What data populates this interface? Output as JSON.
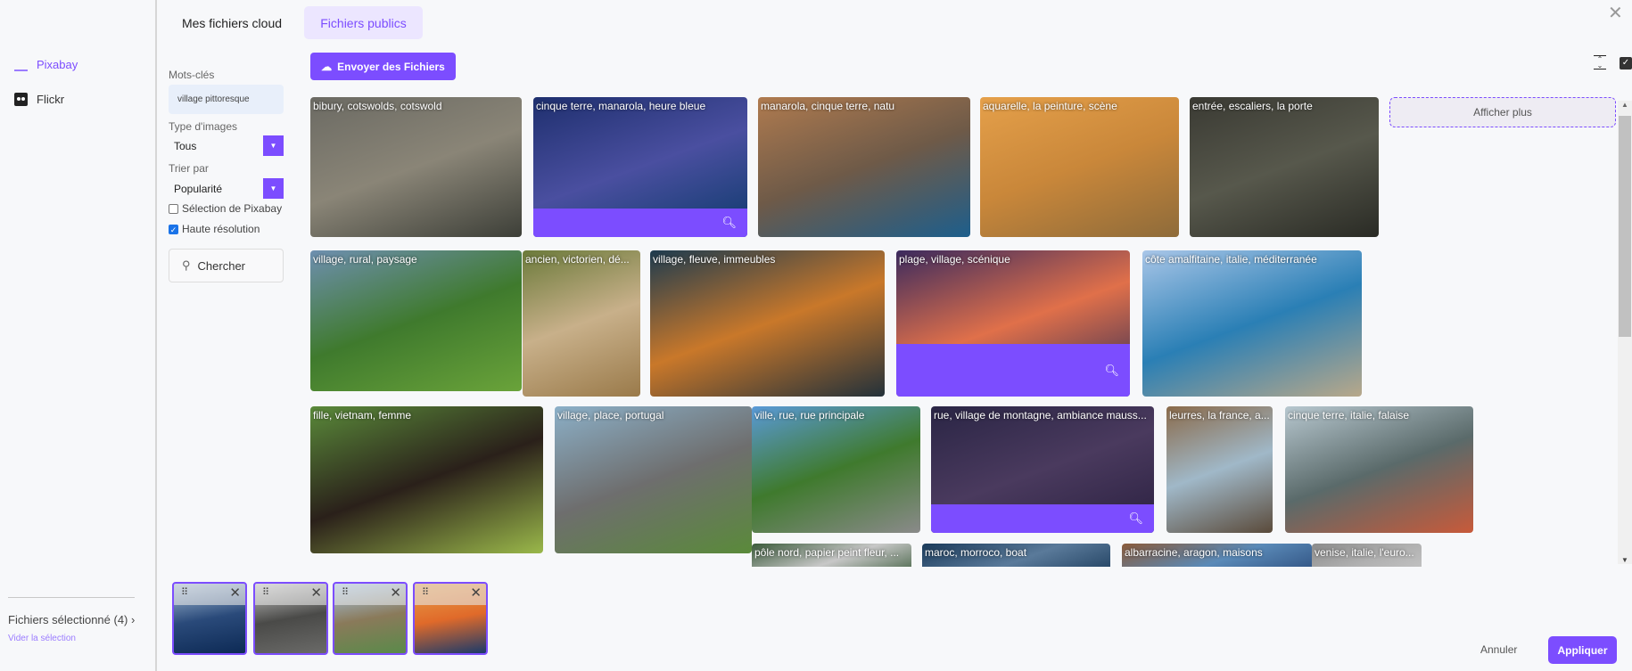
{
  "sidebar": {
    "sources": [
      {
        "label": "Pixabay",
        "icon": "pixabay-icon",
        "active": true
      },
      {
        "label": "Flickr",
        "icon": "flickr-icon"
      }
    ],
    "selected_label": "Fichiers sélectionné (4)",
    "clear_label": "Vider la sélection"
  },
  "tabs": [
    {
      "label": "Mes fichiers cloud"
    },
    {
      "label": "Fichiers publics",
      "active": true
    }
  ],
  "filters": {
    "keywords_label": "Mots-clés",
    "keywords_value": "village pittoresque",
    "type_label": "Type d'images",
    "type_value": "Tous",
    "sort_label": "Trier par",
    "sort_value": "Popularité",
    "pixabay_selection": {
      "label": "Sélection de Pixabay",
      "checked": false
    },
    "high_res": {
      "label": "Haute résolution",
      "checked": true
    },
    "search_label": "Chercher"
  },
  "upload_label": "Envoyer des Fichiers",
  "show_more_label": "Afficher plus",
  "tiles": [
    {
      "caption": "bibury, cotswolds, cotswold"
    },
    {
      "caption": "cinque terre, manarola, heure bleue",
      "selected": true
    },
    {
      "caption": "manarola, cinque terre, natu"
    },
    {
      "caption": "aquarelle, la peinture, scène"
    },
    {
      "caption": "entrée, escaliers, la porte"
    },
    {
      "caption": "village, rural, paysage"
    },
    {
      "caption": "ancien, victorien, dé..."
    },
    {
      "caption": "village, fleuve, immeubles"
    },
    {
      "caption": "plage, village, scénique",
      "selected": true
    },
    {
      "caption": "côte amalfitaine, italie, méditerranée"
    },
    {
      "caption": "fille, vietnam, femme"
    },
    {
      "caption": "village, place, portugal"
    },
    {
      "caption": "ville, rue, rue principale"
    },
    {
      "caption": "rue, village de montagne, ambiance mauss...",
      "selected": true
    },
    {
      "caption": "leurres, la france, a..."
    },
    {
      "caption": "cinque terre, italie, falaise"
    },
    {
      "caption": "pôle nord, papier peint fleur, ..."
    },
    {
      "caption": "maroc, morroco, boat"
    },
    {
      "caption": "albarracine, aragon, maisons"
    },
    {
      "caption": "venise, italie, l'euro..."
    }
  ],
  "selected_count": 4,
  "footer": {
    "cancel_label": "Annuler",
    "apply_label": "Appliquer"
  },
  "colors": {
    "accent": "#7c4dff"
  }
}
